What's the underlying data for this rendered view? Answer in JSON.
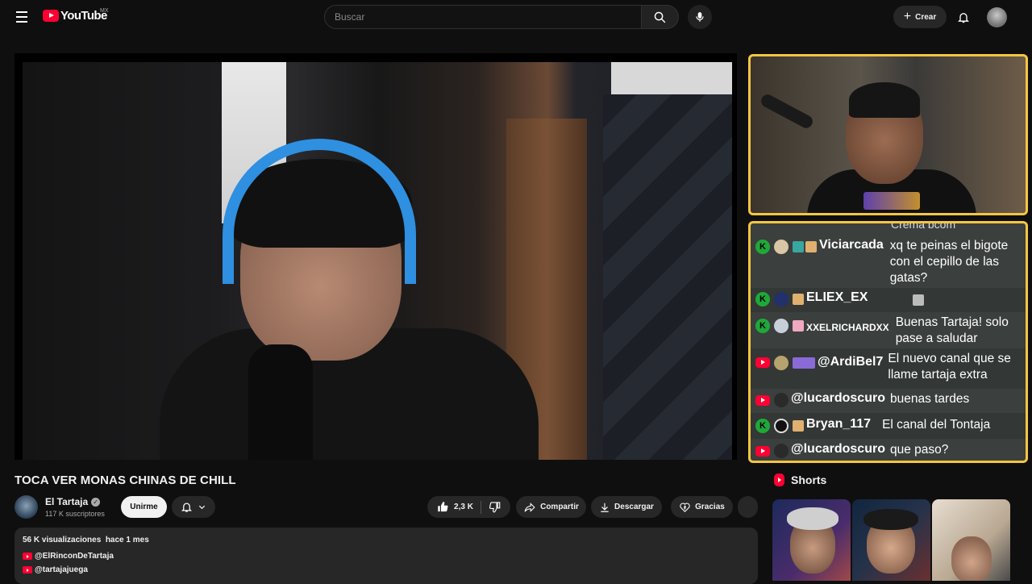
{
  "header": {
    "logo_text": "YouTube",
    "country_code": "MX",
    "search_placeholder": "Buscar",
    "create_label": "Crear"
  },
  "video": {
    "title": "TOCA VER MONAS CHINAS DE CHILL",
    "channel_name": "El Tartaja",
    "subscribers": "117 K suscriptores",
    "join_label": "Unirme",
    "likes": "2,3 K",
    "share_label": "Compartir",
    "download_label": "Descargar",
    "thanks_label": "Gracias"
  },
  "description": {
    "meta": "56 K visualizaciones  hace 1 mes",
    "links": [
      "@ElRinconDeTartaja",
      "@tartajajuega"
    ]
  },
  "chat": {
    "cut_top_text": "Crema bcom",
    "rows": [
      {
        "platform": "kick",
        "user": "Viciarcada",
        "msg": "xq te peinas el bigote con el cepillo de las gatas?"
      },
      {
        "platform": "kick",
        "user": "ELIEX_EX",
        "msg": ""
      },
      {
        "platform": "kick",
        "user": "XXELRICHARDXX",
        "msg": "Buenas Tartaja! solo pase a saludar"
      },
      {
        "platform": "youtube",
        "user": "@ArdiBel7",
        "msg": "El nuevo canal que se llame tartaja extra"
      },
      {
        "platform": "youtube",
        "user": "@lucardoscuro",
        "msg": "buenas tardes"
      },
      {
        "platform": "kick",
        "user": "Bryan_117",
        "msg": "El canal del Tontaja"
      },
      {
        "platform": "youtube",
        "user": "@lucardoscuro",
        "msg": "que paso?"
      }
    ]
  },
  "shorts": {
    "label": "Shorts"
  },
  "colors": {
    "youtube_red": "#ff0033",
    "kick_green": "#1fa83a",
    "overlay_border": "#f5c542"
  },
  "icons": [
    "menu-icon",
    "search-icon",
    "mic-icon",
    "plus-icon",
    "bell-icon",
    "verified-icon",
    "chevron-down-icon",
    "thumbs-up-icon",
    "thumbs-down-icon",
    "share-icon",
    "download-icon",
    "heart-dollar-icon",
    "lock-icon"
  ]
}
